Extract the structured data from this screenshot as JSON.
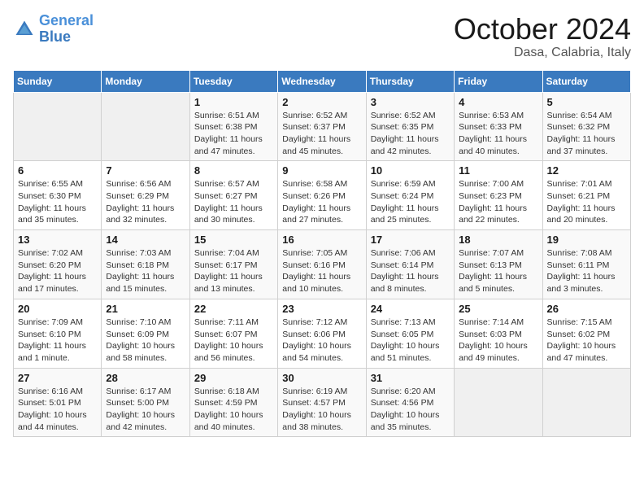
{
  "header": {
    "logo_general": "General",
    "logo_blue": "Blue",
    "month": "October 2024",
    "location": "Dasa, Calabria, Italy"
  },
  "days_of_week": [
    "Sunday",
    "Monday",
    "Tuesday",
    "Wednesday",
    "Thursday",
    "Friday",
    "Saturday"
  ],
  "weeks": [
    [
      {
        "day": "",
        "info": ""
      },
      {
        "day": "",
        "info": ""
      },
      {
        "day": "1",
        "info": "Sunrise: 6:51 AM\nSunset: 6:38 PM\nDaylight: 11 hours and 47 minutes."
      },
      {
        "day": "2",
        "info": "Sunrise: 6:52 AM\nSunset: 6:37 PM\nDaylight: 11 hours and 45 minutes."
      },
      {
        "day": "3",
        "info": "Sunrise: 6:52 AM\nSunset: 6:35 PM\nDaylight: 11 hours and 42 minutes."
      },
      {
        "day": "4",
        "info": "Sunrise: 6:53 AM\nSunset: 6:33 PM\nDaylight: 11 hours and 40 minutes."
      },
      {
        "day": "5",
        "info": "Sunrise: 6:54 AM\nSunset: 6:32 PM\nDaylight: 11 hours and 37 minutes."
      }
    ],
    [
      {
        "day": "6",
        "info": "Sunrise: 6:55 AM\nSunset: 6:30 PM\nDaylight: 11 hours and 35 minutes."
      },
      {
        "day": "7",
        "info": "Sunrise: 6:56 AM\nSunset: 6:29 PM\nDaylight: 11 hours and 32 minutes."
      },
      {
        "day": "8",
        "info": "Sunrise: 6:57 AM\nSunset: 6:27 PM\nDaylight: 11 hours and 30 minutes."
      },
      {
        "day": "9",
        "info": "Sunrise: 6:58 AM\nSunset: 6:26 PM\nDaylight: 11 hours and 27 minutes."
      },
      {
        "day": "10",
        "info": "Sunrise: 6:59 AM\nSunset: 6:24 PM\nDaylight: 11 hours and 25 minutes."
      },
      {
        "day": "11",
        "info": "Sunrise: 7:00 AM\nSunset: 6:23 PM\nDaylight: 11 hours and 22 minutes."
      },
      {
        "day": "12",
        "info": "Sunrise: 7:01 AM\nSunset: 6:21 PM\nDaylight: 11 hours and 20 minutes."
      }
    ],
    [
      {
        "day": "13",
        "info": "Sunrise: 7:02 AM\nSunset: 6:20 PM\nDaylight: 11 hours and 17 minutes."
      },
      {
        "day": "14",
        "info": "Sunrise: 7:03 AM\nSunset: 6:18 PM\nDaylight: 11 hours and 15 minutes."
      },
      {
        "day": "15",
        "info": "Sunrise: 7:04 AM\nSunset: 6:17 PM\nDaylight: 11 hours and 13 minutes."
      },
      {
        "day": "16",
        "info": "Sunrise: 7:05 AM\nSunset: 6:16 PM\nDaylight: 11 hours and 10 minutes."
      },
      {
        "day": "17",
        "info": "Sunrise: 7:06 AM\nSunset: 6:14 PM\nDaylight: 11 hours and 8 minutes."
      },
      {
        "day": "18",
        "info": "Sunrise: 7:07 AM\nSunset: 6:13 PM\nDaylight: 11 hours and 5 minutes."
      },
      {
        "day": "19",
        "info": "Sunrise: 7:08 AM\nSunset: 6:11 PM\nDaylight: 11 hours and 3 minutes."
      }
    ],
    [
      {
        "day": "20",
        "info": "Sunrise: 7:09 AM\nSunset: 6:10 PM\nDaylight: 11 hours and 1 minute."
      },
      {
        "day": "21",
        "info": "Sunrise: 7:10 AM\nSunset: 6:09 PM\nDaylight: 10 hours and 58 minutes."
      },
      {
        "day": "22",
        "info": "Sunrise: 7:11 AM\nSunset: 6:07 PM\nDaylight: 10 hours and 56 minutes."
      },
      {
        "day": "23",
        "info": "Sunrise: 7:12 AM\nSunset: 6:06 PM\nDaylight: 10 hours and 54 minutes."
      },
      {
        "day": "24",
        "info": "Sunrise: 7:13 AM\nSunset: 6:05 PM\nDaylight: 10 hours and 51 minutes."
      },
      {
        "day": "25",
        "info": "Sunrise: 7:14 AM\nSunset: 6:03 PM\nDaylight: 10 hours and 49 minutes."
      },
      {
        "day": "26",
        "info": "Sunrise: 7:15 AM\nSunset: 6:02 PM\nDaylight: 10 hours and 47 minutes."
      }
    ],
    [
      {
        "day": "27",
        "info": "Sunrise: 6:16 AM\nSunset: 5:01 PM\nDaylight: 10 hours and 44 minutes."
      },
      {
        "day": "28",
        "info": "Sunrise: 6:17 AM\nSunset: 5:00 PM\nDaylight: 10 hours and 42 minutes."
      },
      {
        "day": "29",
        "info": "Sunrise: 6:18 AM\nSunset: 4:59 PM\nDaylight: 10 hours and 40 minutes."
      },
      {
        "day": "30",
        "info": "Sunrise: 6:19 AM\nSunset: 4:57 PM\nDaylight: 10 hours and 38 minutes."
      },
      {
        "day": "31",
        "info": "Sunrise: 6:20 AM\nSunset: 4:56 PM\nDaylight: 10 hours and 35 minutes."
      },
      {
        "day": "",
        "info": ""
      },
      {
        "day": "",
        "info": ""
      }
    ]
  ]
}
